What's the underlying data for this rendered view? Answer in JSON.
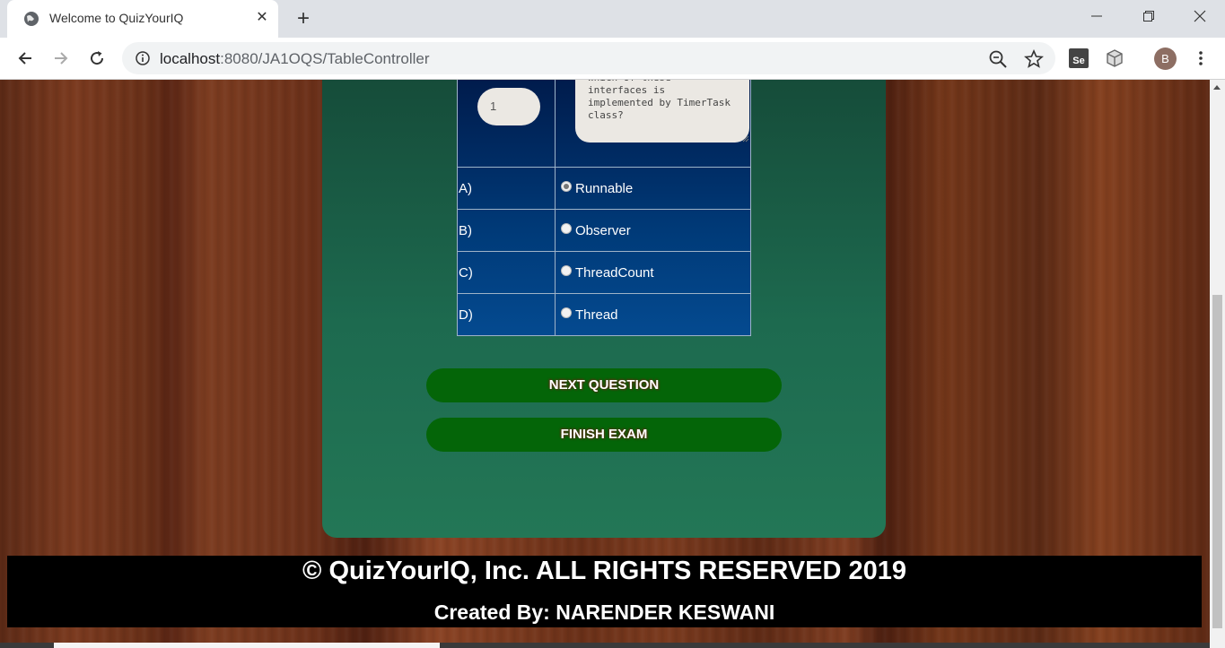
{
  "browser": {
    "tab_title": "Welcome to QuizYourIQ",
    "url_host": "localhost",
    "url_path": ":8080/JA1OQS/TableController",
    "profile_initial": "B",
    "extension_label": "Se"
  },
  "quiz": {
    "question_number": "1",
    "question_text": "Which of these\ninterfaces is\nimplemented by TimerTask\nclass?",
    "options": [
      {
        "label": "A)",
        "text": "Runnable",
        "selected": true
      },
      {
        "label": "B)",
        "text": "Observer",
        "selected": false
      },
      {
        "label": "C)",
        "text": "ThreadCount",
        "selected": false
      },
      {
        "label": "D)",
        "text": "Thread",
        "selected": false
      }
    ],
    "next_button": "NEXT QUESTION",
    "finish_button": "FINISH EXAM"
  },
  "footer": {
    "copyright": "© QuizYourIQ, Inc. ALL RIGHTS RESERVED 2019",
    "created_by": "Created By: NARENDER KESWANI"
  },
  "colors": {
    "panel": "#1d6a4f",
    "button": "#046508",
    "table": "#003a78"
  }
}
